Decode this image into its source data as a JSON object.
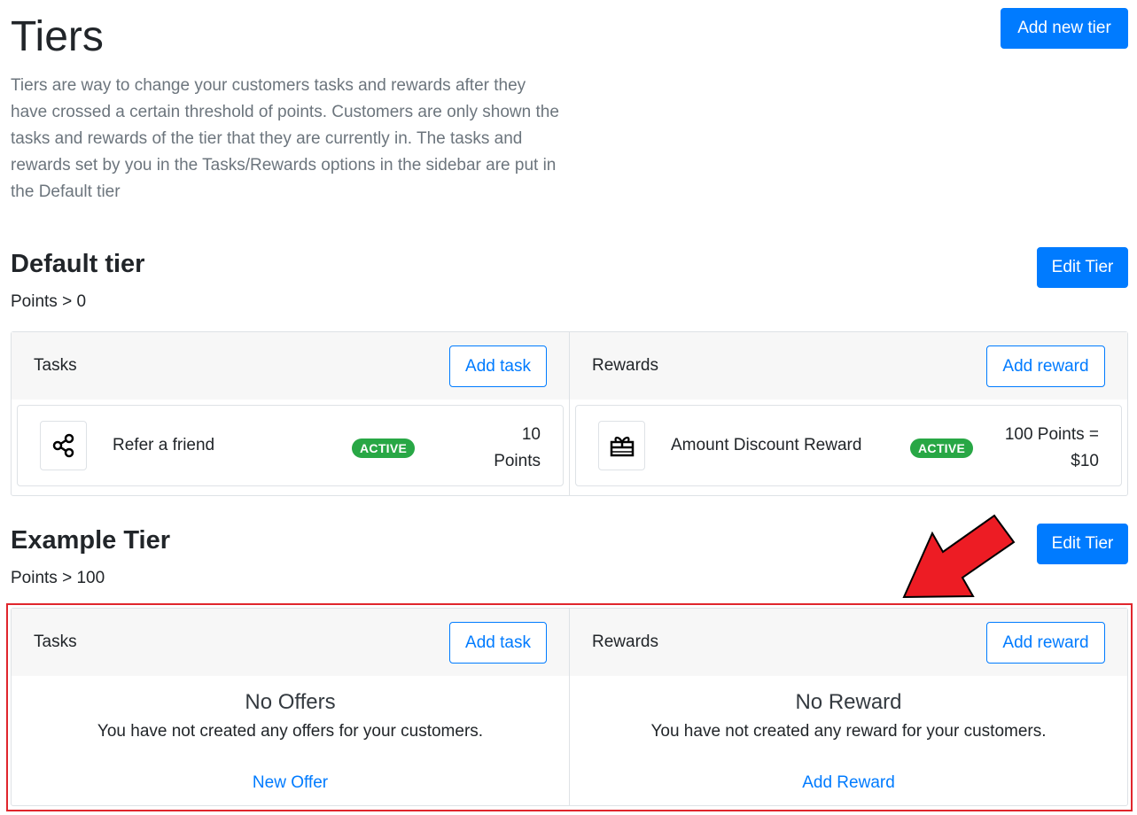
{
  "header": {
    "title": "Tiers",
    "description": "Tiers are way to change your customers tasks and rewards after they have crossed a certain threshold of points. Customers are only shown the tasks and rewards of the tier that they are currently in. The tasks and rewards set by you in the Tasks/Rewards options in the sidebar are put in the Default tier",
    "add_tier_label": "Add new tier"
  },
  "tiers": [
    {
      "name": "Default tier",
      "points": "Points > 0",
      "edit_label": "Edit Tier",
      "tasks": {
        "heading": "Tasks",
        "add_label": "Add task",
        "items": [
          {
            "icon": "share-icon",
            "name": "Refer a friend",
            "status": "ACTIVE",
            "value": "10 Points"
          }
        ]
      },
      "rewards": {
        "heading": "Rewards",
        "add_label": "Add reward",
        "items": [
          {
            "icon": "gift-icon",
            "name": "Amount Discount Reward",
            "status": "ACTIVE",
            "value": "100 Points = $10"
          }
        ]
      }
    },
    {
      "name": "Example Tier",
      "points": "Points > 100",
      "edit_label": "Edit Tier",
      "tasks": {
        "heading": "Tasks",
        "add_label": "Add task",
        "empty_title": "No Offers",
        "empty_text": "You have not created any offers for your customers.",
        "empty_link": "New Offer"
      },
      "rewards": {
        "heading": "Rewards",
        "add_label": "Add reward",
        "empty_title": "No Reward",
        "empty_text": "You have not created any reward for your customers.",
        "empty_link": "Add Reward"
      }
    }
  ],
  "colors": {
    "primary": "#007bff",
    "success": "#28a745",
    "annotation": "#e0262d"
  }
}
